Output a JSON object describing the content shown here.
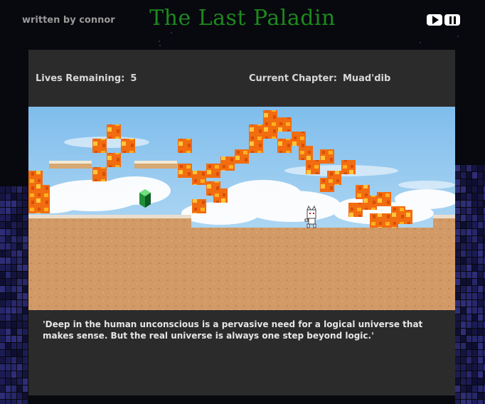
{
  "header": {
    "author": "written by connor",
    "title": "The Last Paladin",
    "play_icon": "play-icon",
    "pause_icon": "pause-icon"
  },
  "hud": {
    "lives_label": "Lives Remaining:",
    "lives_value": "5",
    "chapter_label": "Current Chapter:",
    "chapter_value": "Muad'dib"
  },
  "quote": "'Deep in the human unconscious is a pervasive need for a logical universe that makes sense. But the real universe is always one step beyond logic.'",
  "colors": {
    "title": "#1c8a1c",
    "panel": "#2b2b2b",
    "sky": "#8ec6ef",
    "sand": "#d39a68",
    "lava": "#f06a10",
    "gem": "#1f8f3a"
  },
  "scene_icons": [
    "lava-block",
    "green-gem",
    "player-cat",
    "cloud",
    "sand-platform"
  ]
}
